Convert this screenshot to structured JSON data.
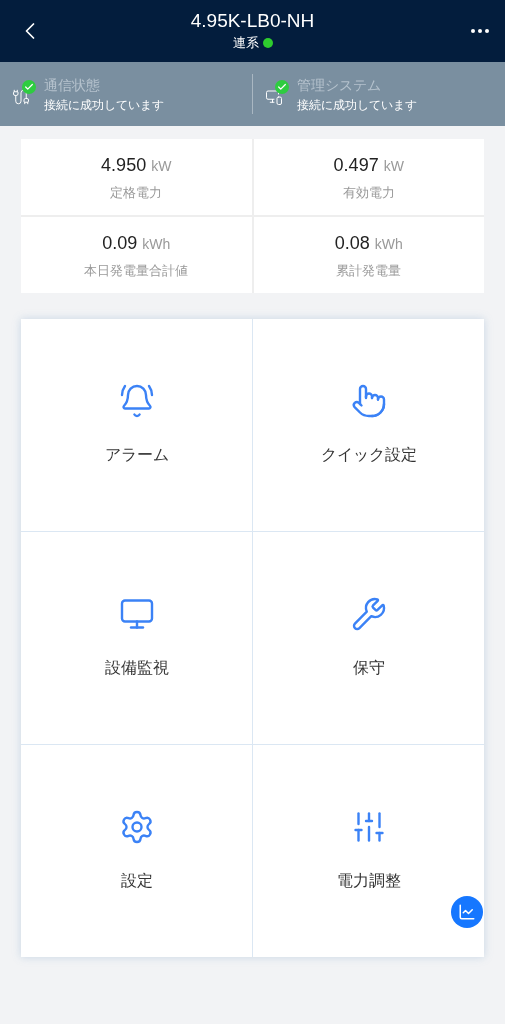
{
  "header": {
    "title": "4.95K-LB0-NH",
    "status": "連系",
    "online": true
  },
  "connections": [
    {
      "kind": "communication",
      "title": "通信状態",
      "detail": "接続に成功しています",
      "connected": true
    },
    {
      "kind": "management",
      "title": "管理システム",
      "detail": "接続に成功しています",
      "connected": true
    }
  ],
  "stats": [
    {
      "value": "4.950",
      "unit": "kW",
      "label": "定格電力"
    },
    {
      "value": "0.497",
      "unit": "kW",
      "label": "有効電力"
    },
    {
      "value": "0.09",
      "unit": "kWh",
      "label": "本日発電量合計値"
    },
    {
      "value": "0.08",
      "unit": "kWh",
      "label": "累計発電量"
    }
  ],
  "menu": [
    {
      "kind": "alarm",
      "label": "アラーム"
    },
    {
      "kind": "quick",
      "label": "クイック設定"
    },
    {
      "kind": "monitor",
      "label": "設備監視"
    },
    {
      "kind": "maintenance",
      "label": "保守"
    },
    {
      "kind": "settings",
      "label": "設定"
    },
    {
      "kind": "power",
      "label": "電力調整"
    }
  ]
}
